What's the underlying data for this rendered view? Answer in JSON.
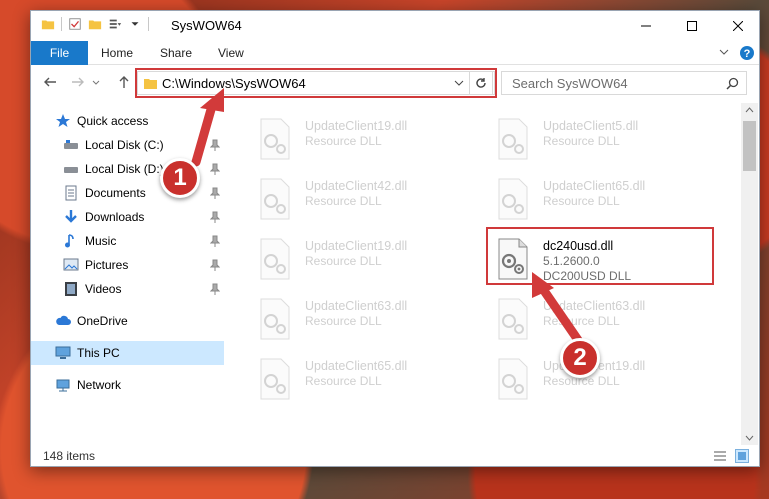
{
  "window": {
    "title": "SysWOW64"
  },
  "ribbon": {
    "tabs": [
      "File",
      "Home",
      "Share",
      "View"
    ]
  },
  "address": {
    "path": "C:\\Windows\\SysWOW64",
    "search_placeholder": "Search SysWOW64"
  },
  "sidebar": {
    "items": [
      {
        "label": "Quick access",
        "icon": "star-icon"
      },
      {
        "label": "Local Disk (C:)",
        "icon": "drive-icon"
      },
      {
        "label": "Local Disk (D:)",
        "icon": "drive-icon"
      },
      {
        "label": "Documents",
        "icon": "documents-icon"
      },
      {
        "label": "Downloads",
        "icon": "download-arrow-icon"
      },
      {
        "label": "Music",
        "icon": "music-note-icon"
      },
      {
        "label": "Pictures",
        "icon": "pictures-icon"
      },
      {
        "label": "Videos",
        "icon": "videos-icon"
      },
      {
        "label": "OneDrive",
        "icon": "cloud-icon"
      },
      {
        "label": "This PC",
        "icon": "monitor-icon"
      },
      {
        "label": "Network",
        "icon": "network-icon"
      }
    ]
  },
  "files": [
    {
      "name": "UpdateClient19.dll",
      "type": "Resource DLL"
    },
    {
      "name": "UpdateClient5.dll",
      "type": "Resource DLL"
    },
    {
      "name": "UpdateClient42.dll",
      "type": "Resource DLL"
    },
    {
      "name": "UpdateClient65.dll",
      "type": "Resource DLL"
    },
    {
      "name": "UpdateClient19.dll",
      "type": "Resource DLL"
    },
    {
      "name": "dc240usd.dll",
      "version": "5.1.2600.0",
      "type": "DC200USD DLL"
    },
    {
      "name": "UpdateClient63.dll",
      "type": "Resource DLL"
    },
    {
      "name": "UpdateClient63.dll",
      "type": "Resource DLL"
    },
    {
      "name": "UpdateClient65.dll",
      "type": "Resource DLL"
    },
    {
      "name": "UpdateClient19.dll",
      "type": "Resource DLL"
    }
  ],
  "status": {
    "item_count": "148 items"
  },
  "annotations": {
    "step1": "1",
    "step2": "2"
  },
  "colors": {
    "accent": "#1979ca",
    "highlight": "#d0393a"
  }
}
